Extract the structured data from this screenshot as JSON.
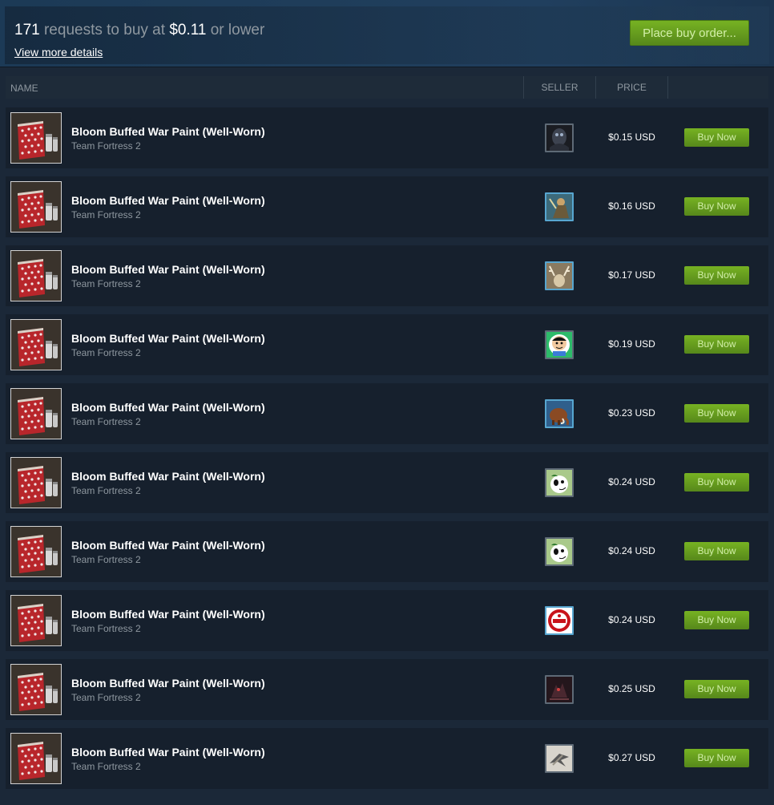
{
  "buy_order": {
    "count": "171",
    "text_requests": "requests to buy at",
    "price": "$0.11",
    "text_lower": "or lower",
    "details_link": "View more details",
    "button_label": "Place buy order..."
  },
  "header": {
    "name": "NAME",
    "seller": "SELLER",
    "price": "PRICE"
  },
  "buy_label": "Buy Now",
  "listings": [
    {
      "name": "Bloom Buffed War Paint (Well-Worn)",
      "game": "Team Fortress 2",
      "price": "$0.15 USD",
      "avatar": "dark-armored-figure",
      "online": false
    },
    {
      "name": "Bloom Buffed War Paint (Well-Worn)",
      "game": "Team Fortress 2",
      "price": "$0.16 USD",
      "avatar": "fantasy-warrior",
      "online": true
    },
    {
      "name": "Bloom Buffed War Paint (Well-Worn)",
      "game": "Team Fortress 2",
      "price": "$0.17 USD",
      "avatar": "deer-antlers",
      "online": true
    },
    {
      "name": "Bloom Buffed War Paint (Well-Worn)",
      "game": "Team Fortress 2",
      "price": "$0.19 USD",
      "avatar": "cartoon-face",
      "online": false
    },
    {
      "name": "Bloom Buffed War Paint (Well-Worn)",
      "game": "Team Fortress 2",
      "price": "$0.23 USD",
      "avatar": "mammoth",
      "online": true
    },
    {
      "name": "Bloom Buffed War Paint (Well-Worn)",
      "game": "Team Fortress 2",
      "price": "$0.24 USD",
      "avatar": "green-dog",
      "online": false
    },
    {
      "name": "Bloom Buffed War Paint (Well-Worn)",
      "game": "Team Fortress 2",
      "price": "$0.24 USD",
      "avatar": "green-dog",
      "online": false
    },
    {
      "name": "Bloom Buffed War Paint (Well-Worn)",
      "game": "Team Fortress 2",
      "price": "$0.24 USD",
      "avatar": "red-badge",
      "online": true
    },
    {
      "name": "Bloom Buffed War Paint (Well-Worn)",
      "game": "Team Fortress 2",
      "price": "$0.25 USD",
      "avatar": "dark-creature",
      "online": false
    },
    {
      "name": "Bloom Buffed War Paint (Well-Worn)",
      "game": "Team Fortress 2",
      "price": "$0.27 USD",
      "avatar": "bird-sketch",
      "online": false
    }
  ]
}
